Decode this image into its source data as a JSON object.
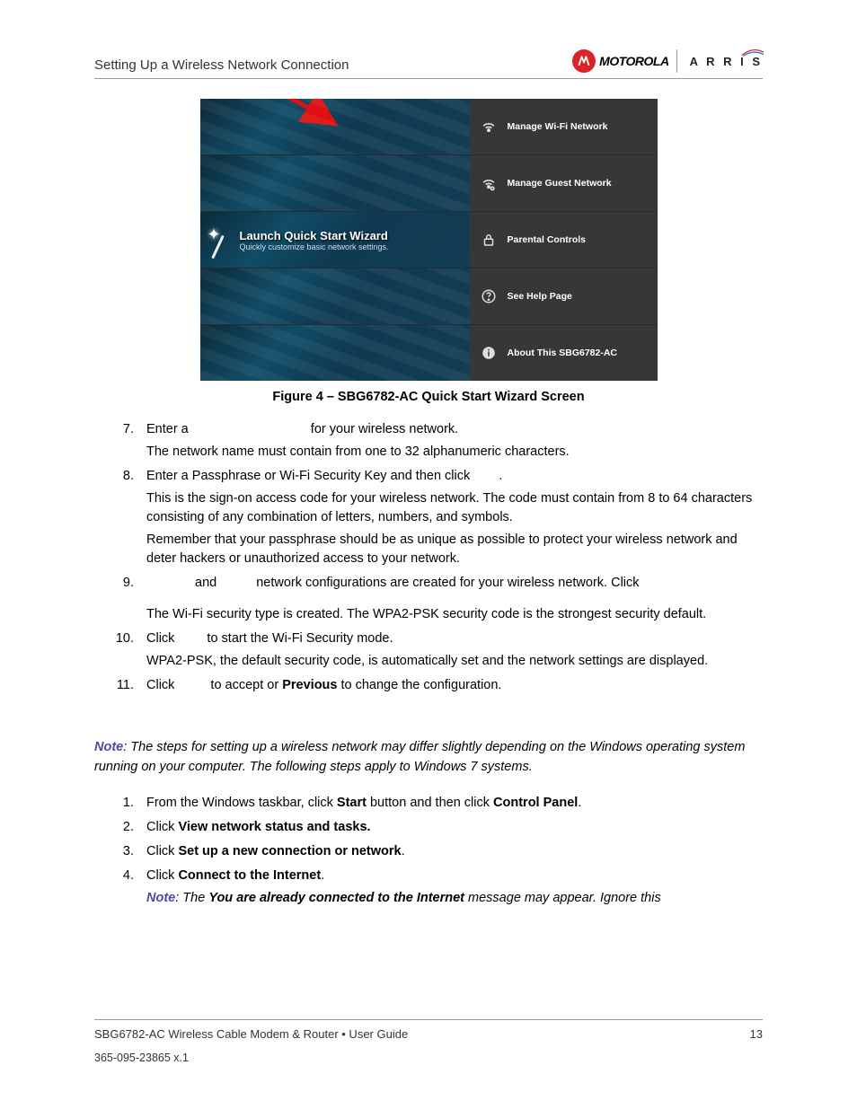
{
  "header": {
    "section_title": "Setting Up a Wireless Network Connection"
  },
  "logos": {
    "motorola": "MOTOROLA",
    "arris": "A R R I S"
  },
  "figure": {
    "caption": "Figure 4 – SBG6782-AC Quick Start Wizard Screen",
    "wizard_title": "Launch Quick Start Wizard",
    "wizard_sub": "Quickly customize basic network settings.",
    "menu": {
      "m1": "Manage Wi-Fi Network",
      "m2": "Manage Guest Network",
      "m3": "Parental Controls",
      "m4": "See Help Page",
      "m5": "About This SBG6782-AC"
    }
  },
  "steps": {
    "s7a": "Enter a ",
    "s7b": " for your wireless network.",
    "s7c": "The network name must contain from one to 32 alphanumeric characters.",
    "s8a": "Enter a Passphrase or Wi-Fi Security Key and then click ",
    "s8dot": ".",
    "s8b": "This is the sign-on access code for your wireless network. The code must contain from 8 to 64 characters consisting of any combination of letters, numbers, and symbols.",
    "s8c": "Remember that your passphrase should be as unique as possible to protect your wireless network and deter hackers or unauthorized access to your network.",
    "s9a": "and",
    "s9b": "network configurations are created for your wireless network. Click",
    "s9c": "The Wi-Fi security type is created. The WPA2-PSK security code is the strongest security default.",
    "s10a": "Click",
    "s10b": "to start the Wi-Fi Security mode.",
    "s10c": "WPA2-PSK, the default security code, is automatically set and the network settings are displayed.",
    "s11a": "Click",
    "s11b": "to accept or ",
    "s11prev": "Previous",
    "s11c": " to change the configuration."
  },
  "note": {
    "label": "Note",
    "body": ": The steps for setting up a wireless network may differ slightly depending on the Windows operating system running on your computer. The following steps apply to Windows 7 systems."
  },
  "steps2": {
    "s1a": "From the Windows taskbar, click ",
    "s1b": "Start",
    "s1c": " button and then click ",
    "s1d": "Control Panel",
    "s1e": ".",
    "s2a": "Click ",
    "s2b": "View network status and tasks.",
    "s3a": "Click ",
    "s3b": "Set up a new connection or network",
    "s3c": ".",
    "s4a": "Click ",
    "s4b": "Connect to the Internet",
    "s4c": ".",
    "s4note_label": "Note",
    "s4note_a": ": The ",
    "s4note_b": "You are already connected to the Internet",
    "s4note_c": " message may appear. Ignore this"
  },
  "footer": {
    "left": "SBG6782-AC Wireless Cable Modem & Router • User Guide",
    "right": "13",
    "docnum": "365-095-23865  x.1"
  }
}
